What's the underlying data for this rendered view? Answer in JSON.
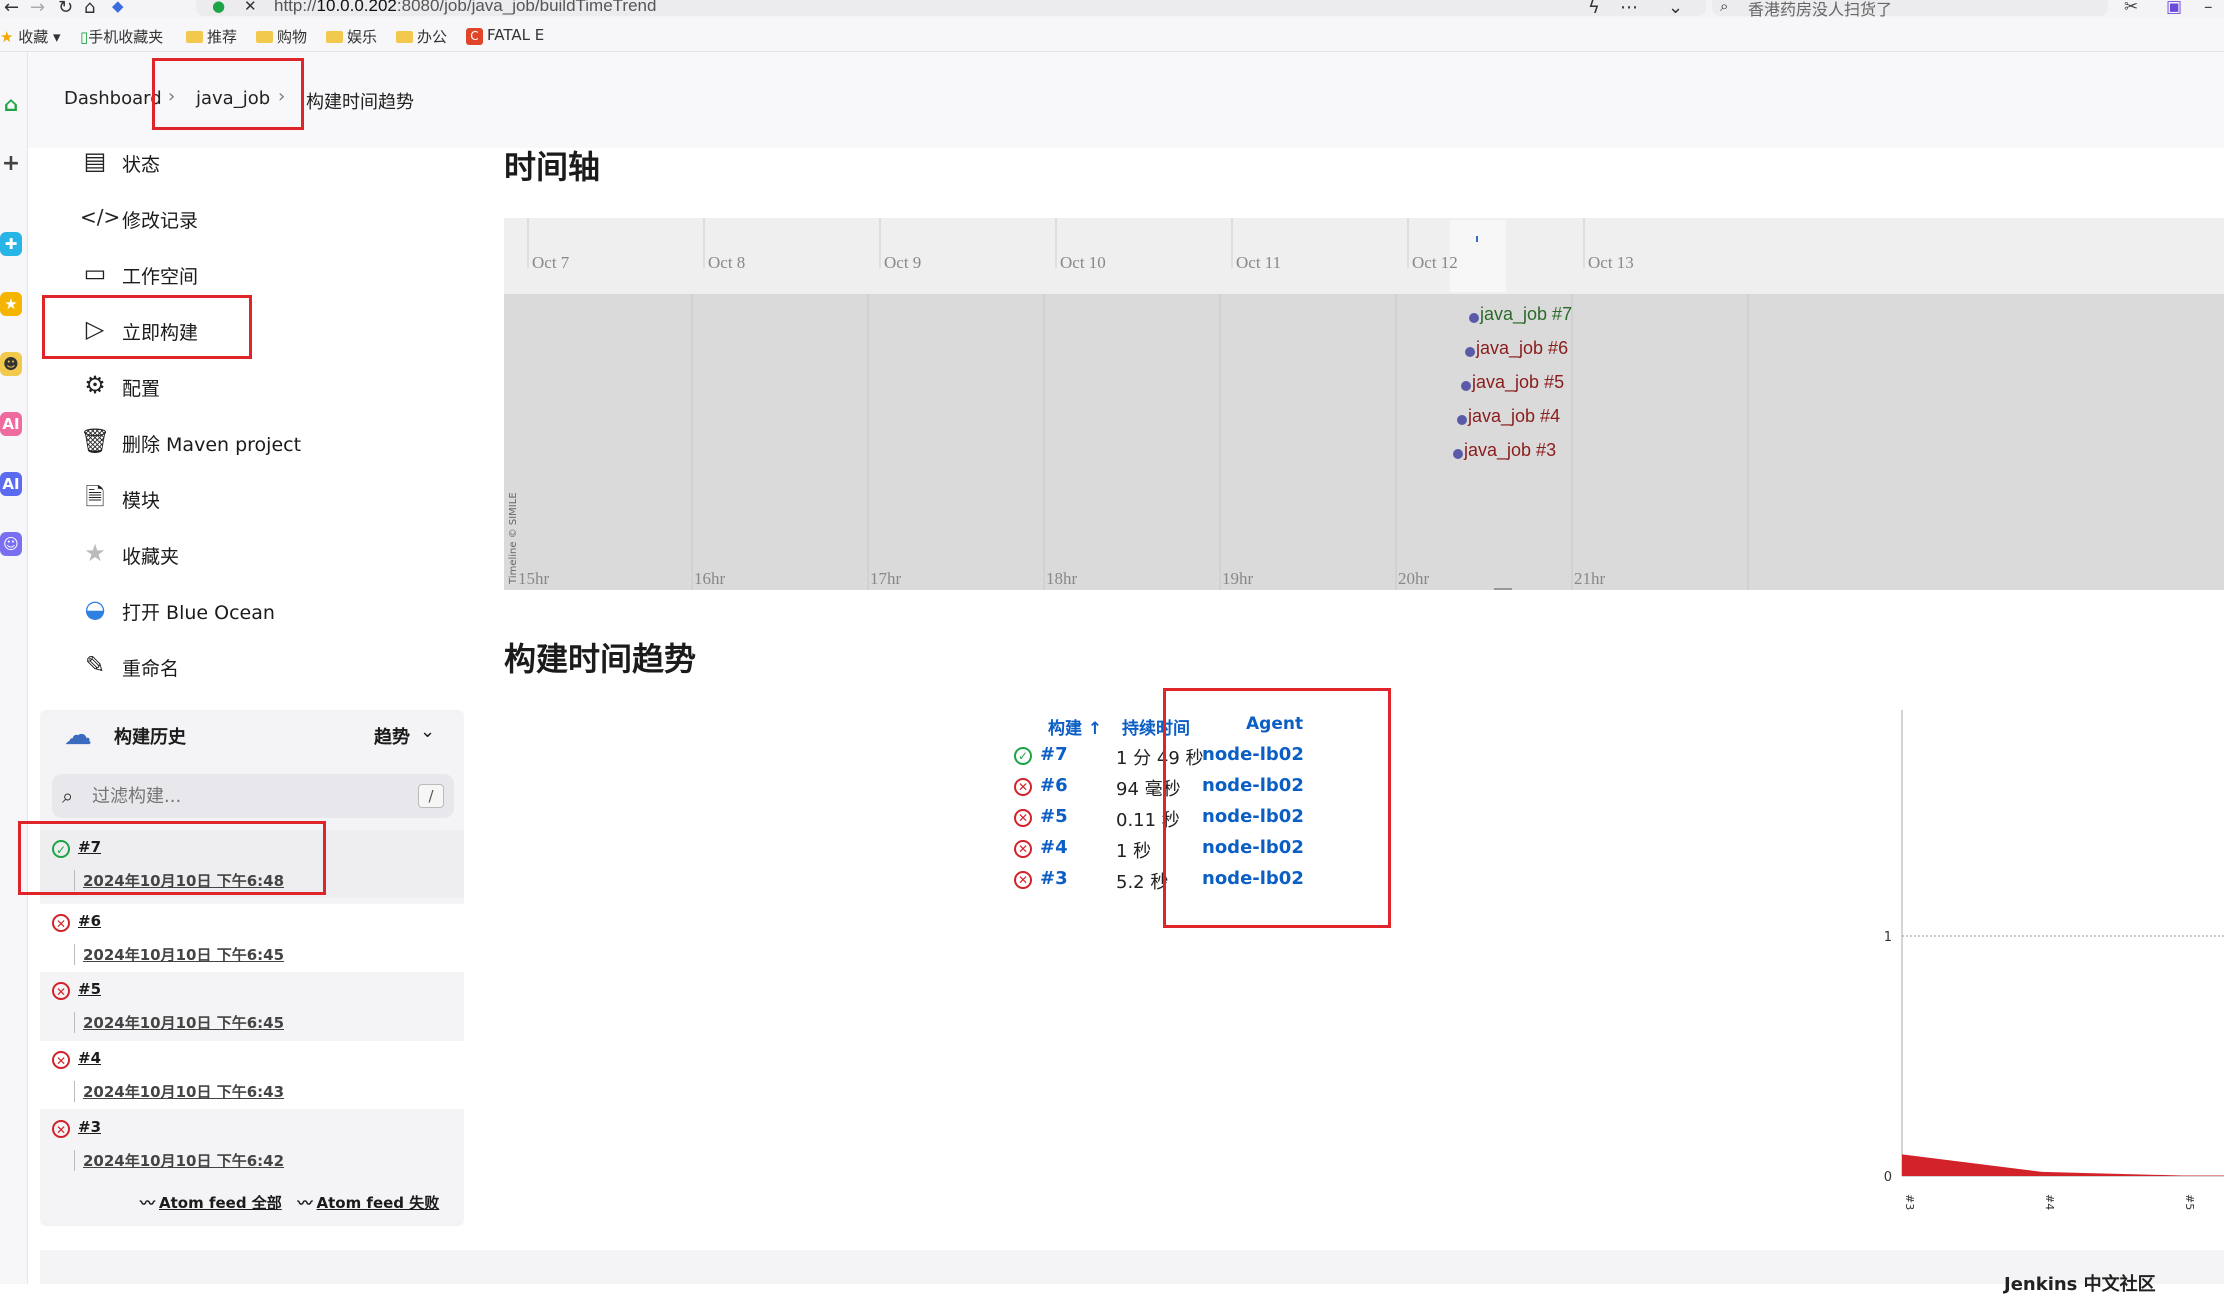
{
  "browser": {
    "url_prefix": "http://",
    "url_host": "10.0.0.202",
    "url_rest": ":8080/job/java_job/buildTimeTrend",
    "search_text": "香港药房没人扫货了",
    "bookmarks": [
      "收藏",
      "手机收藏夹",
      "推荐",
      "购物",
      "娱乐",
      "办公",
      "FATAL E"
    ]
  },
  "breadcrumb": {
    "dashboard": "Dashboard",
    "job": "java_job",
    "page": "构建时间趋势"
  },
  "tasks": [
    {
      "label": "状态",
      "icon": "status-icon"
    },
    {
      "label": "修改记录",
      "icon": "code-icon"
    },
    {
      "label": "工作空间",
      "icon": "folder-icon"
    },
    {
      "label": "立即构建",
      "icon": "play-icon"
    },
    {
      "label": "配置",
      "icon": "gear-icon"
    },
    {
      "label": "删除 Maven project",
      "icon": "trash-icon"
    },
    {
      "label": "模块",
      "icon": "document-icon"
    },
    {
      "label": "收藏夹",
      "icon": "star-icon"
    },
    {
      "label": "打开 Blue Ocean",
      "icon": "blue-ocean-icon"
    },
    {
      "label": "重命名",
      "icon": "pencil-icon"
    }
  ],
  "history": {
    "title": "构建历史",
    "trend": "趋势",
    "filter_placeholder": "过滤构建...",
    "filter_key": "/",
    "builds": [
      {
        "num": "#7",
        "date": "2024年10月10日 下午6:48",
        "status": "success"
      },
      {
        "num": "#6",
        "date": "2024年10月10日 下午6:45",
        "status": "failed"
      },
      {
        "num": "#5",
        "date": "2024年10月10日 下午6:45",
        "status": "failed"
      },
      {
        "num": "#4",
        "date": "2024年10月10日 下午6:43",
        "status": "failed"
      },
      {
        "num": "#3",
        "date": "2024年10月10日 下午6:42",
        "status": "failed"
      }
    ],
    "atom_all": "Atom feed 全部",
    "atom_fail": "Atom feed 失败"
  },
  "timeline": {
    "title": "时间轴",
    "day_labels": [
      "Oct 7",
      "Oct 8",
      "Oct 9",
      "Oct 10",
      "Oct 11",
      "Oct 12",
      "Oct 13"
    ],
    "hour_labels": [
      "15hr",
      "16hr",
      "17hr",
      "18hr",
      "19hr",
      "20hr",
      "21hr"
    ],
    "credit": "Timeline © SIMILE",
    "events": [
      {
        "label": "java_job #7",
        "status": "success"
      },
      {
        "label": "java_job #6",
        "status": "failed"
      },
      {
        "label": "java_job #5",
        "status": "failed"
      },
      {
        "label": "java_job #4",
        "status": "failed"
      },
      {
        "label": "java_job #3",
        "status": "failed"
      }
    ]
  },
  "trend": {
    "title": "构建时间趋势",
    "col_build": "构建 ↑",
    "col_duration": "持续时间",
    "col_agent": "Agent",
    "rows": [
      {
        "num": "#7",
        "duration": "1 分 49 秒",
        "agent": "node-lb02",
        "status": "success"
      },
      {
        "num": "#6",
        "duration": "94 毫秒",
        "agent": "node-lb02",
        "status": "failed"
      },
      {
        "num": "#5",
        "duration": "0.11 秒",
        "agent": "node-lb02",
        "status": "failed"
      },
      {
        "num": "#4",
        "duration": "1 秒",
        "agent": "node-lb02",
        "status": "failed"
      },
      {
        "num": "#3",
        "duration": "5.2 秒",
        "agent": "node-lb02",
        "status": "failed"
      }
    ]
  },
  "chart_data": {
    "type": "area",
    "x": [
      "#3",
      "#4",
      "#5"
    ],
    "y_ticks": [
      "0",
      "1"
    ],
    "series": [
      {
        "values": [
          0.09,
          0.017,
          0.002
        ],
        "color": "#d2232a"
      }
    ],
    "ylim": [
      0,
      1
    ]
  },
  "footer": {
    "text": "Jenkins 中文社区"
  }
}
